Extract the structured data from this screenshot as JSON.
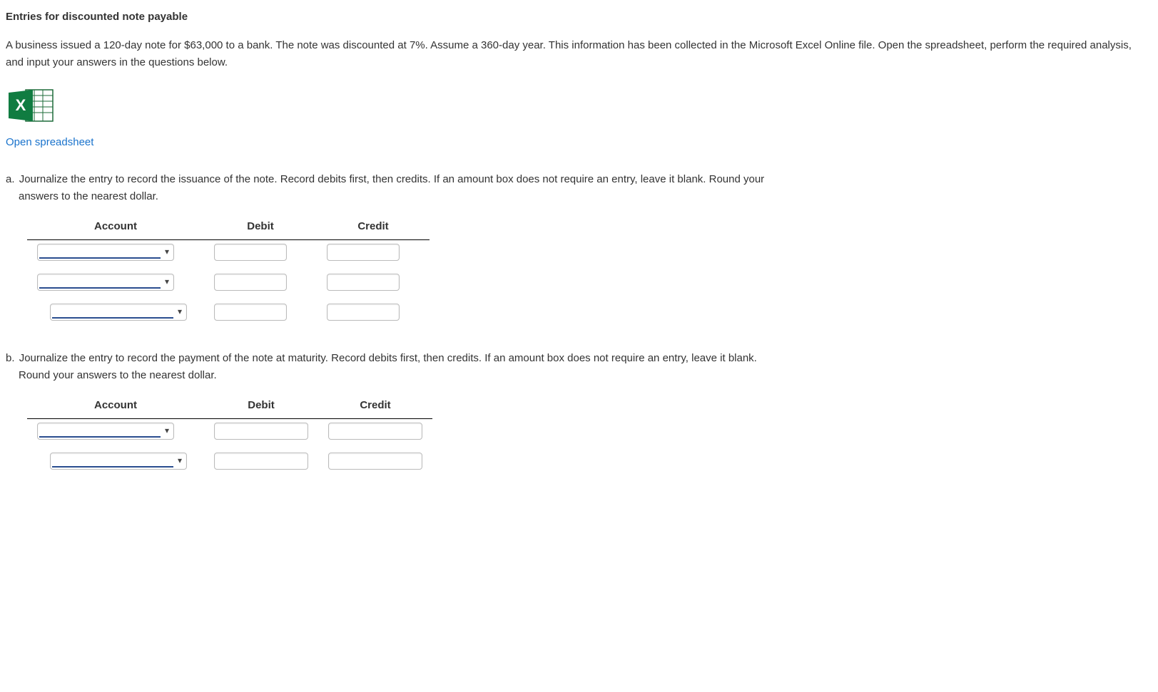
{
  "title": "Entries for discounted note payable",
  "intro": "A business issued a 120-day note for $63,000 to a bank. The note was discounted at 7%. Assume a 360-day year. This information has been collected in the Microsoft Excel Online file. Open the spreadsheet, perform the required analysis, and input your answers in the questions below.",
  "open_link": "Open spreadsheet",
  "part_a": {
    "letter": "a.",
    "text_line1": "Journalize the entry to record the issuance of the note. Record debits first, then credits. If an amount box does not require an entry, leave it blank. Round your",
    "text_line2": "answers to the nearest dollar.",
    "headers": {
      "account": "Account",
      "debit": "Debit",
      "credit": "Credit"
    }
  },
  "part_b": {
    "letter": "b.",
    "text_line1": "Journalize the entry to record the payment of the note at maturity. Record debits first, then credits. If an amount box does not require an entry, leave it blank.",
    "text_line2": "Round your answers to the nearest dollar.",
    "headers": {
      "account": "Account",
      "debit": "Debit",
      "credit": "Credit"
    }
  }
}
